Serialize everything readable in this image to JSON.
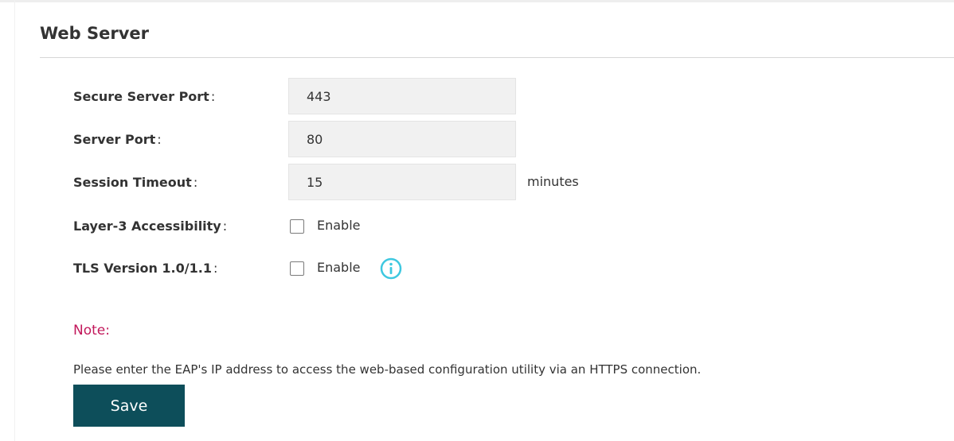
{
  "section": {
    "title": "Web Server"
  },
  "fields": {
    "secure_server_port": {
      "label": "Secure Server Port",
      "value": "443"
    },
    "server_port": {
      "label": "Server Port",
      "value": "80"
    },
    "session_timeout": {
      "label": "Session Timeout",
      "value": "15",
      "suffix": "minutes"
    },
    "layer3_accessibility": {
      "label": "Layer-3 Accessibility",
      "option": "Enable",
      "checked": false
    },
    "tls_version": {
      "label": "TLS Version 1.0/1.1",
      "option": "Enable",
      "checked": false
    }
  },
  "colon": ":",
  "note": {
    "title": "Note:",
    "text": "Please enter the EAP's IP address to access the web-based configuration utility via an HTTPS connection."
  },
  "actions": {
    "save_label": "Save"
  },
  "icons": {
    "info": "info-icon"
  },
  "colors": {
    "accent": "#0d4e5a",
    "note": "#c2185b",
    "info": "#3ec8e0"
  }
}
